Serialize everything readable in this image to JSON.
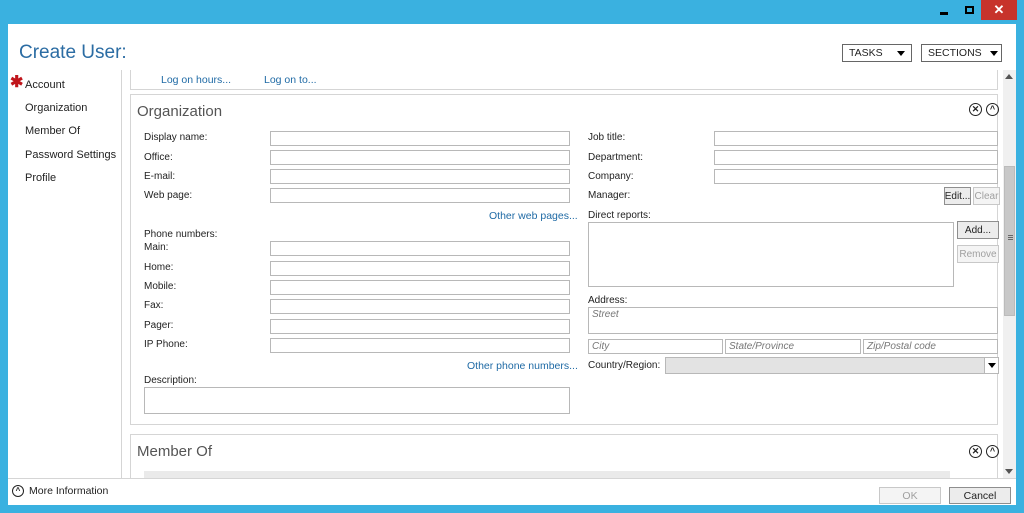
{
  "window": {
    "min_glyph": "minimize-icon",
    "max_glyph": "maximize-icon",
    "close_glyph": "✕",
    "frame_color": "#3ab1e0",
    "close_color": "#c7332b"
  },
  "header": {
    "title": "Create User:",
    "tasks_label": "TASKS",
    "sections_label": "SECTIONS"
  },
  "nav": {
    "items": [
      {
        "label": "Account",
        "required": true
      },
      {
        "label": "Organization"
      },
      {
        "label": "Member Of"
      },
      {
        "label": "Password Settings"
      },
      {
        "label": "Profile"
      }
    ],
    "required_glyph": "✱"
  },
  "account_links": {
    "logon_hours": "Log on hours...",
    "logon_to": "Log on to..."
  },
  "organization": {
    "title": "Organization",
    "close_glyph": "✕",
    "collapse_glyph": "^",
    "left_fields": [
      {
        "label": "Display name:",
        "value": ""
      },
      {
        "label": "Office:",
        "value": ""
      },
      {
        "label": "E-mail:",
        "value": ""
      },
      {
        "label": "Web page:",
        "value": ""
      }
    ],
    "other_web_pages": "Other web pages...",
    "phone_header": "Phone numbers:",
    "phone_fields": [
      {
        "label": "Main:",
        "value": ""
      },
      {
        "label": "Home:",
        "value": ""
      },
      {
        "label": "Mobile:",
        "value": ""
      },
      {
        "label": "Fax:",
        "value": ""
      },
      {
        "label": "Pager:",
        "value": ""
      },
      {
        "label": "IP Phone:",
        "value": ""
      }
    ],
    "other_phone_numbers": "Other phone numbers...",
    "description_label": "Description:",
    "right_fields": [
      {
        "label": "Job title:",
        "value": ""
      },
      {
        "label": "Department:",
        "value": ""
      },
      {
        "label": "Company:",
        "value": ""
      }
    ],
    "manager_label": "Manager:",
    "edit_label": "Edit...",
    "clear_label": "Clear",
    "direct_reports_label": "Direct reports:",
    "add_label": "Add...",
    "remove_label": "Remove",
    "address_label": "Address:",
    "street_placeholder": "Street",
    "city_placeholder": "City",
    "state_placeholder": "State/Province",
    "zip_placeholder": "Zip/Postal code",
    "country_label": "Country/Region:",
    "country_value": ""
  },
  "member_of": {
    "title": "Member Of",
    "close_glyph": "✕",
    "collapse_glyph": "^"
  },
  "footer": {
    "more_info": "More Information",
    "more_info_glyph": "^",
    "ok_label": "OK",
    "cancel_label": "Cancel"
  }
}
